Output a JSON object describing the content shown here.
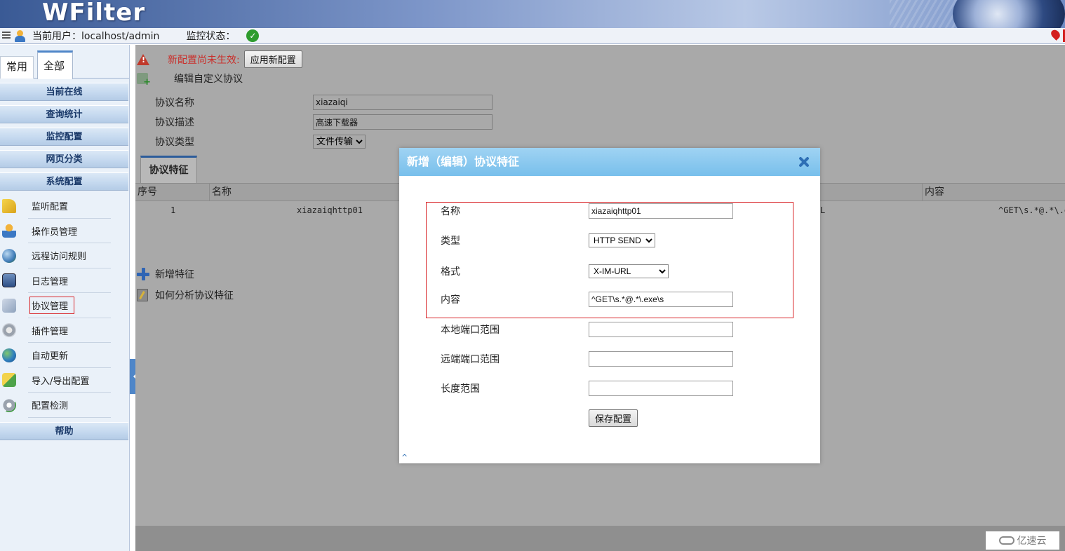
{
  "header": {
    "logo": "WFilter",
    "user_label": "当前用户：localhost/admin",
    "status_label": "监控状态："
  },
  "sidebar": {
    "tabs": [
      "常用",
      "全部"
    ],
    "sections": [
      "当前在线",
      "查询统计",
      "监控配置",
      "网页分类",
      "系统配置"
    ],
    "items": [
      {
        "label": "监听配置",
        "icon": "warning-icon"
      },
      {
        "label": "操作员管理",
        "icon": "user-icon"
      },
      {
        "label": "远程访问规则",
        "icon": "globe-icon"
      },
      {
        "label": "日志管理",
        "icon": "log-icon"
      },
      {
        "label": "协议管理",
        "icon": "protocol-icon"
      },
      {
        "label": "插件管理",
        "icon": "plugin-icon"
      },
      {
        "label": "自动更新",
        "icon": "update-globe-icon"
      },
      {
        "label": "导入/导出配置",
        "icon": "import-export-icon"
      },
      {
        "label": "配置检测",
        "icon": "gear-check-icon"
      }
    ],
    "help": "帮助"
  },
  "main": {
    "alert_text": "新配置尚未生效:",
    "apply_button": "应用新配置",
    "edit_title": "编辑自定义协议",
    "form": {
      "name_label": "协议名称",
      "name_value": "xiazaiqi",
      "desc_label": "协议描述",
      "desc_value": "高速下载器",
      "type_label": "协议类型",
      "type_value": "文件传输"
    },
    "feature_tab": "协议特征",
    "table": {
      "headers": [
        "序号",
        "名称",
        "内容"
      ],
      "rows": [
        {
          "index": "1",
          "name": "xiazaiqhttp01",
          "partial": "L",
          "content": "^GET\\s.*@.*\\.e"
        }
      ]
    },
    "add_feature": "新增特征",
    "how_to": "如何分析协议特征"
  },
  "modal": {
    "title": "新增（编辑）协议特征",
    "fields": {
      "name_label": "名称",
      "name_value": "xiazaiqhttp01",
      "type_label": "类型",
      "type_value": "HTTP SEND",
      "format_label": "格式",
      "format_value": "X-IM-URL",
      "content_label": "内容",
      "content_value": "^GET\\s.*@.*\\.exe\\s",
      "local_port_label": "本地端口范围",
      "local_port_value": "",
      "remote_port_label": "远端端口范围",
      "remote_port_value": "",
      "length_label": "长度范围",
      "length_value": ""
    },
    "save_button": "保存配置"
  },
  "watermark": "亿速云",
  "colors": {
    "modal_header": "#78bfeb",
    "alert_red": "#c9302c",
    "highlight_box": "#d9262a",
    "status_ok": "#2e9c2e"
  }
}
